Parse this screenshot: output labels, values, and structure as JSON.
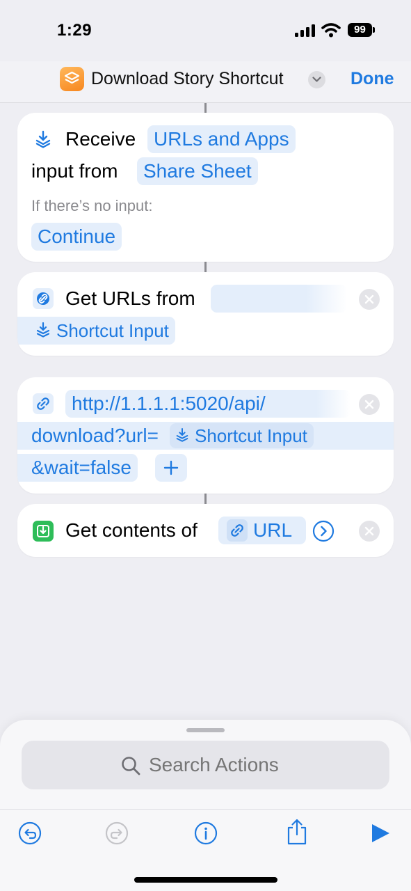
{
  "status_bar": {
    "time": "1:29",
    "battery": "99"
  },
  "header": {
    "title": "Download Story Shortcut",
    "done_label": "Done"
  },
  "actions": {
    "receive": {
      "verb": "Receive",
      "input_type": "URLs and Apps",
      "input_from_label": "input from",
      "source": "Share Sheet",
      "no_input_label": "If there’s no input:",
      "no_input_action": "Continue"
    },
    "get_urls": {
      "verb": "Get URLs from",
      "variable": "Shortcut Input"
    },
    "url": {
      "line1": "http://1.1.1.1:5020/api/",
      "line2_prefix": "download?url=",
      "variable": "Shortcut Input",
      "line3": "&wait=false"
    },
    "get_contents": {
      "verb": "Get contents of",
      "variable": "URL"
    }
  },
  "search": {
    "placeholder": "Search Actions"
  },
  "toolbar": [
    "undo",
    "redo",
    "info",
    "share",
    "run"
  ],
  "colors": {
    "accent": "#1f7ae0",
    "token_bg": "#e4eefb",
    "app_icon": "#f7871f"
  }
}
